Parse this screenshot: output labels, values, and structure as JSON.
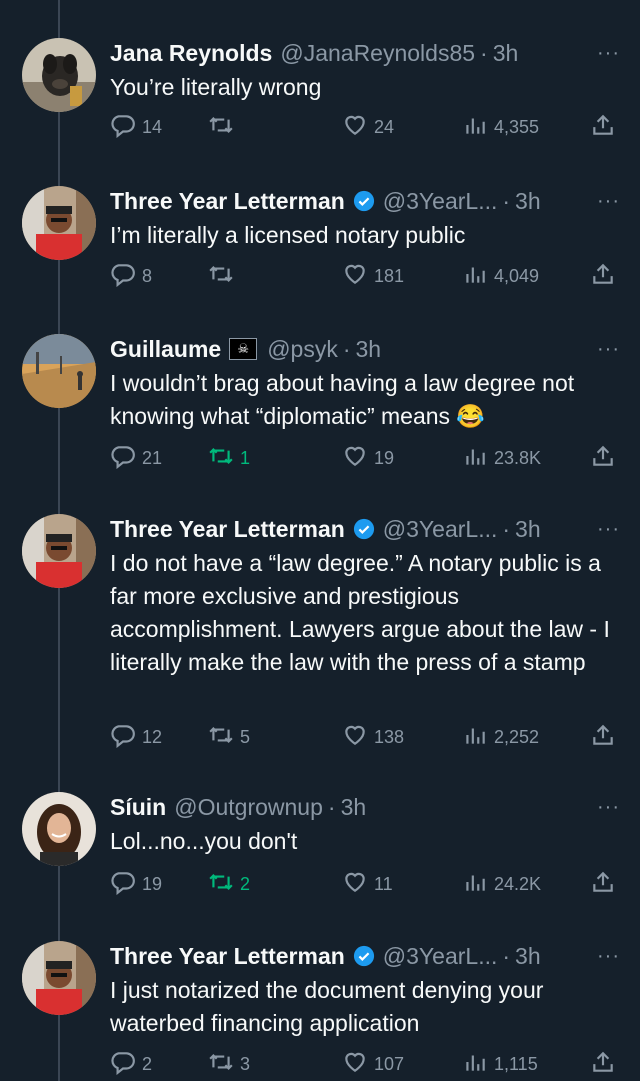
{
  "tweets": [
    {
      "name": "Jana Reynolds",
      "handle": "@JanaReynolds85",
      "time": "3h",
      "verified": false,
      "flag": false,
      "text": "You’re literally wrong",
      "replies": "14",
      "retweets": "",
      "likes": "24",
      "views": "4,355",
      "retweeted": false,
      "avatar": "dog-photo"
    },
    {
      "name": "Three Year Letterman",
      "handle": "@3YearL...",
      "time": "3h",
      "verified": true,
      "flag": false,
      "text": "I’m literally a licensed notary public",
      "replies": "8",
      "retweets": "",
      "likes": "181",
      "views": "4,049",
      "retweeted": false,
      "avatar": "man-red-shirt-photo"
    },
    {
      "name": "Guillaume",
      "handle": "@psyk",
      "time": "3h",
      "verified": false,
      "flag": true,
      "text": "I wouldn’t brag about having a law degree not knowing what “diplomatic” means 😂",
      "replies": "21",
      "retweets": "1",
      "likes": "19",
      "views": "23.8K",
      "retweeted": true,
      "avatar": "street-photo"
    },
    {
      "name": "Three Year Letterman",
      "handle": "@3YearL...",
      "time": "3h",
      "verified": true,
      "flag": false,
      "text": "I do not have a “law degree.” A notary public is a far more exclusive and prestigious accomplishment. Lawyers argue about the law - I literally make the law with the press of a stamp",
      "replies": "12",
      "retweets": "5",
      "likes": "138",
      "views": "2,252",
      "retweeted": false,
      "avatar": "man-red-shirt-photo"
    },
    {
      "name": "Síuin",
      "handle": "@Outgrownup",
      "time": "3h",
      "verified": false,
      "flag": false,
      "text": "Lol...no...you don't",
      "replies": "19",
      "retweets": "2",
      "likes": "11",
      "views": "24.2K",
      "retweeted": true,
      "avatar": "woman-photo"
    },
    {
      "name": "Three Year Letterman",
      "handle": "@3YearL...",
      "time": "3h",
      "verified": true,
      "flag": false,
      "text": "I just notarized the document denying your waterbed financing application",
      "replies": "2",
      "retweets": "3",
      "likes": "107",
      "views": "1,115",
      "retweeted": false,
      "avatar": "man-red-shirt-photo"
    }
  ],
  "separator": "·",
  "more_label": "···",
  "colors": {
    "background": "#15202b",
    "text": "#f7f9f9",
    "muted": "#8b98a5",
    "verified": "#1d9bf0",
    "retweet_active": "#00ba7c"
  }
}
